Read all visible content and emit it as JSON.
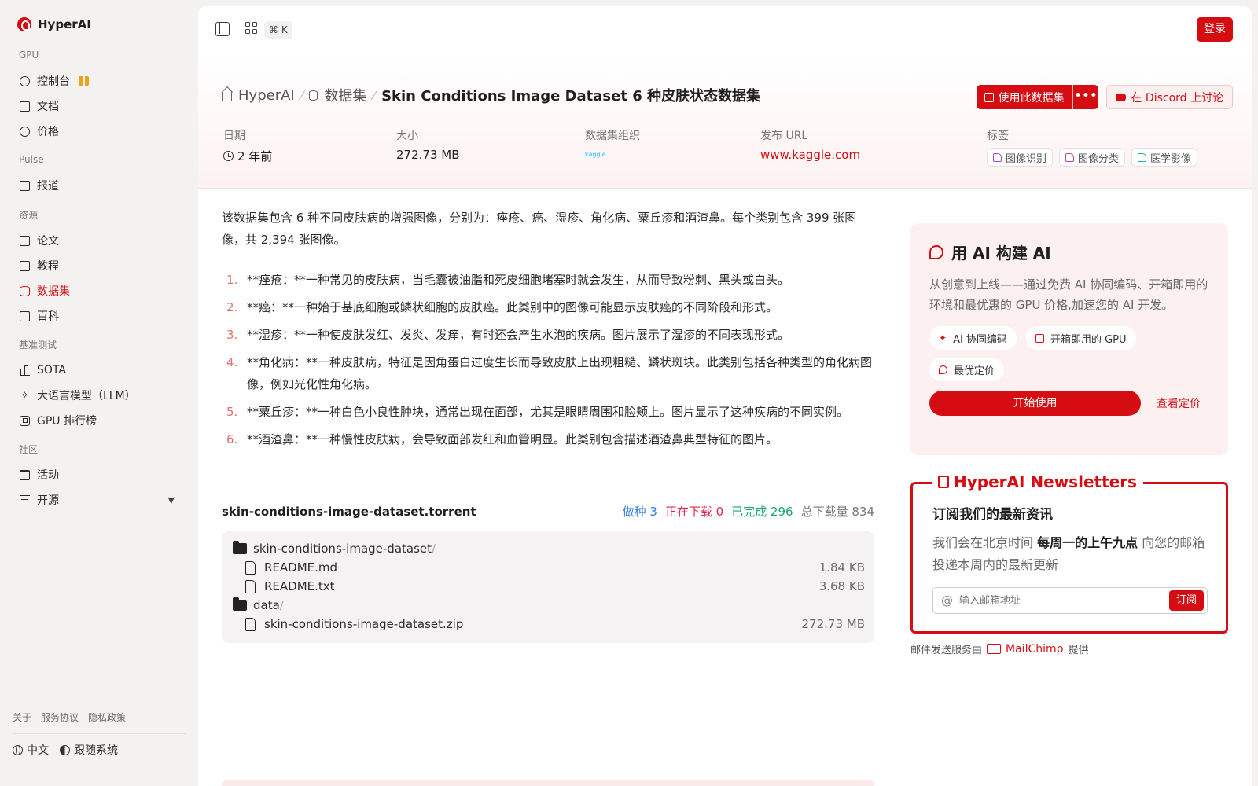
{
  "brand": {
    "name": "HyperAI"
  },
  "sidebar": {
    "sections": [
      {
        "heading": "GPU",
        "items": [
          {
            "label": "控制台",
            "icon": "dashboard-icon",
            "badge": "gift-icon"
          },
          {
            "label": "文档",
            "icon": "document-icon"
          },
          {
            "label": "价格",
            "icon": "price-icon"
          }
        ]
      },
      {
        "heading": "Pulse",
        "items": [
          {
            "label": "报道",
            "icon": "news-icon"
          }
        ]
      },
      {
        "heading": "资源",
        "items": [
          {
            "label": "论文",
            "icon": "paper-icon"
          },
          {
            "label": "教程",
            "icon": "tutorial-icon"
          },
          {
            "label": "数据集",
            "icon": "database-icon",
            "active": true
          },
          {
            "label": "百科",
            "icon": "wiki-icon"
          }
        ]
      },
      {
        "heading": "基准测试",
        "items": [
          {
            "label": "SOTA",
            "icon": "chart-bars-icon"
          },
          {
            "label": "大语言模型（LLM）",
            "icon": "sparkle-icon"
          },
          {
            "label": "GPU 排行榜",
            "icon": "chip-icon"
          }
        ]
      },
      {
        "heading": "社区",
        "items": [
          {
            "label": "活动",
            "icon": "calendar-icon"
          },
          {
            "label": "开源",
            "icon": "list-icon",
            "expandable": true
          }
        ]
      }
    ],
    "footer_links": [
      "关于",
      "服务协议",
      "隐私政策"
    ],
    "language": "中文",
    "theme": "跟随系统"
  },
  "topbar": {
    "shortcut": "⌘ K",
    "login": "登录"
  },
  "breadcrumb": {
    "home": "HyperAI",
    "section": "数据集",
    "current": "Skin Conditions Image Dataset 6 种皮肤状态数据集"
  },
  "actions": {
    "use_dataset": "使用此数据集",
    "more": "•••",
    "discord": "在 Discord 上讨论"
  },
  "meta": {
    "date_label": "日期",
    "date_value": "2 年前",
    "size_label": "大小",
    "size_value": "272.73 MB",
    "org_label": "数据集组织",
    "org_value": "kaggle",
    "url_label": "发布 URL",
    "url_value": "www.kaggle.com",
    "tags_label": "标签",
    "tags": [
      "图像识别",
      "图像分类",
      "医学影像"
    ]
  },
  "description": "该数据集包含 6 种不同皮肤病的增强图像，分别为：痤疮、癌、湿疹、角化病、粟丘疹和酒渣鼻。每个类别包含 399 张图像，共 2,394 张图像。",
  "conditions": [
    {
      "n": "1.",
      "text": "**痤疮：**一种常见的皮肤病，当毛囊被油脂和死皮细胞堵塞时就会发生，从而导致粉刺、黑头或白头。"
    },
    {
      "n": "2.",
      "text": "**癌：**一种始于基底细胞或鳞状细胞的皮肤癌。此类别中的图像可能显示皮肤癌的不同阶段和形式。"
    },
    {
      "n": "3.",
      "text": "**湿疹：**一种使皮肤发红、发炎、发痒，有时还会产生水泡的疾病。图片展示了湿疹的不同表现形式。"
    },
    {
      "n": "4.",
      "text": "**角化病：**一种皮肤病，特征是因角蛋白过度生长而导致皮肤上出现粗糙、鳞状斑块。此类别包括各种类型的角化病图像，例如光化性角化病。"
    },
    {
      "n": "5.",
      "text": "**粟丘疹：**一种白色小良性肿块，通常出现在面部，尤其是眼睛周围和脸颊上。图片显示了这种疾病的不同实例。"
    },
    {
      "n": "6.",
      "text": "**酒渣鼻：**一种慢性皮肤病，会导致面部发红和血管明显。此类别包含描述酒渣鼻典型特征的图片。"
    }
  ],
  "torrent": {
    "filename": "skin-conditions-image-dataset.torrent",
    "seeding": "做种 3",
    "downloading": "正在下载 0",
    "completed": "已完成 296",
    "total": "总下载量 834",
    "files": [
      {
        "name": "skin-conditions-image-dataset",
        "type": "folder",
        "size": ""
      },
      {
        "name": "README.md",
        "type": "file",
        "size": "1.84 KB"
      },
      {
        "name": "README.txt",
        "type": "file",
        "size": "3.68 KB"
      },
      {
        "name": "data",
        "type": "folder",
        "size": ""
      },
      {
        "name": "skin-conditions-image-dataset.zip",
        "type": "file",
        "size": "272.73 MB"
      }
    ]
  },
  "ai_card": {
    "title": "用 AI 构建 AI",
    "desc": "从创意到上线——通过免费 AI 协同编码、开箱即用的环境和最优惠的 GPU 价格,加速您的 AI 开发。",
    "chips": [
      "AI 协同编码",
      "开箱即用的 GPU",
      "最优定价"
    ],
    "cta": "开始使用",
    "link": "查看定价"
  },
  "newsletter": {
    "legend": "HyperAI Newsletters",
    "title": "订阅我们的最新资讯",
    "text_pre": "我们会在北京时间 ",
    "text_bold": "每周一的上午九点",
    "text_post": " 向您的邮箱投递本周内的最新更新",
    "placeholder": "输入邮箱地址",
    "subscribe": "订阅",
    "footer_pre": "邮件发送服务由",
    "footer_brand": "MailChimp",
    "footer_post": "提供"
  },
  "colors": {
    "accent": "#d50d12",
    "sidebar_bg": "#f4f1f1"
  }
}
